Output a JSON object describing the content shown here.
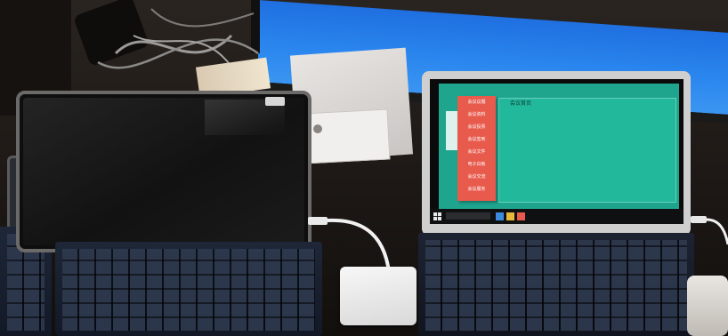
{
  "scene": {
    "description_for_alt": "",
    "right_tablet_window": {
      "title": "会议首页",
      "menu_items": [
        "会议议题",
        "会议资料",
        "会议投票",
        "会议签到",
        "会议文件",
        "电子白板",
        "会议交流",
        "会议服务"
      ]
    },
    "taskbar": {
      "clock_time": "",
      "clock_date": ""
    }
  },
  "colors": {
    "desktop_teal": "#1fa58e",
    "menu_red": "#e75a4c",
    "monitor_blue": "#2a86ee"
  }
}
